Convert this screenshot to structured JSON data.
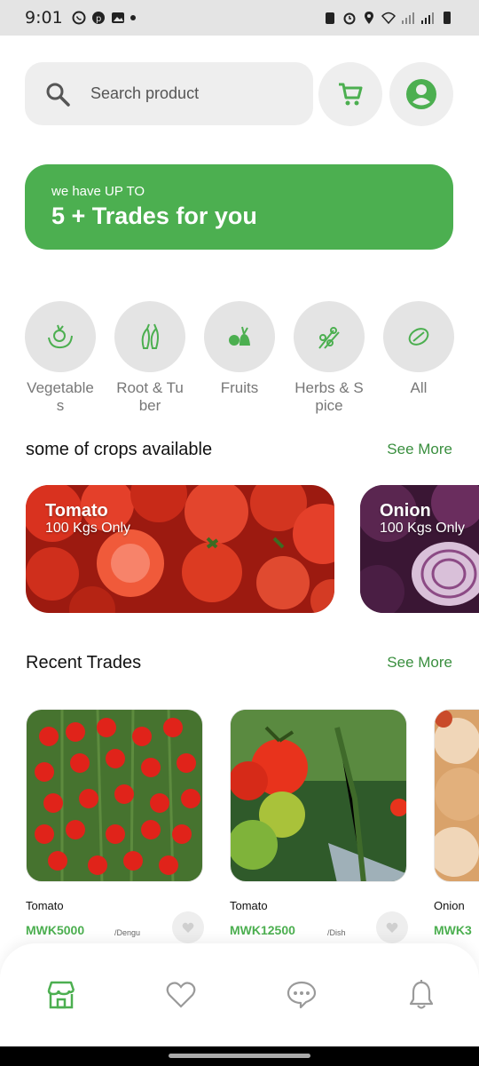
{
  "status_bar": {
    "time": "9:01"
  },
  "search": {
    "placeholder": "Search product"
  },
  "banner": {
    "subtitle": "we have UP TO",
    "title": "5 + Trades for you"
  },
  "categories": [
    {
      "label": "Vegetables",
      "icon": "vegetable-icon"
    },
    {
      "label": "Root & Tuber",
      "icon": "root-tuber-icon"
    },
    {
      "label": "Fruits",
      "icon": "fruits-icon"
    },
    {
      "label": "Herbs & Spice",
      "icon": "herbs-spice-icon"
    },
    {
      "label": "All",
      "icon": "all-icon"
    }
  ],
  "crops_section": {
    "title": "some of crops available",
    "see_more": "See More"
  },
  "crops": [
    {
      "name": "Tomato",
      "quantity": "100 Kgs Only"
    },
    {
      "name": "Onion",
      "quantity": "100 Kgs Only"
    }
  ],
  "recent_section": {
    "title": "Recent Trades",
    "see_more": "See More"
  },
  "trades": [
    {
      "name": "Tomato",
      "price": "MWK5000",
      "unit": "/Dengu"
    },
    {
      "name": "Tomato",
      "price": "MWK12500",
      "unit": "/Dish"
    },
    {
      "name": "Onion",
      "price": "MWK3",
      "unit": ""
    }
  ],
  "bottom_nav": [
    "store-icon",
    "heart-icon",
    "chat-icon",
    "bell-icon"
  ],
  "colors": {
    "primary": "#4caf50",
    "link": "#3a8f3f",
    "chip_bg": "#eeeeee"
  }
}
